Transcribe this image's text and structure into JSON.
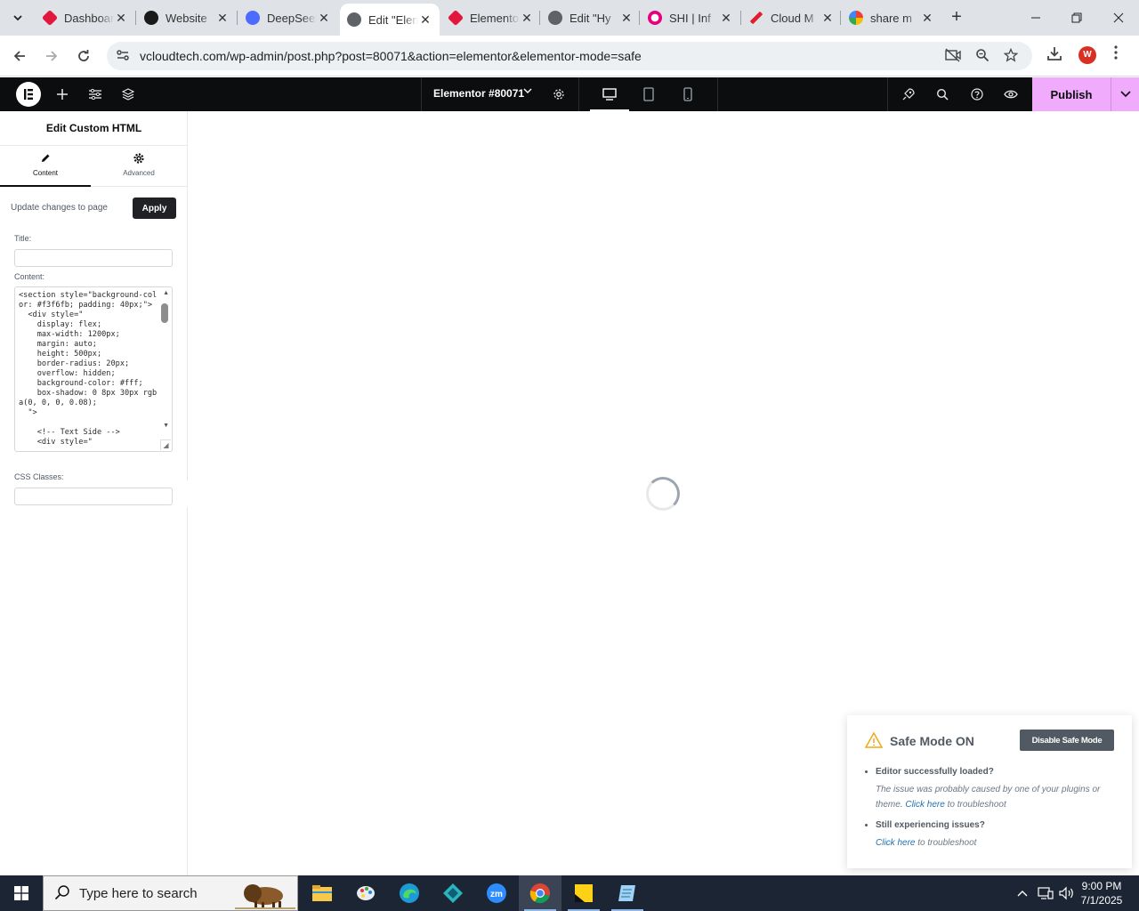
{
  "browser": {
    "tabs": [
      {
        "label": "Dashboard",
        "fav": "#e2173e"
      },
      {
        "label": "Website",
        "fav": "#1a1a1a"
      },
      {
        "label": "DeepSeek",
        "fav": "#4d6bfe"
      },
      {
        "label": "Edit \"Elementor\"",
        "fav": "#555555"
      },
      {
        "label": "Elementor",
        "fav": "#e2173e"
      },
      {
        "label": "Edit \"Hy",
        "fav": "#555555"
      },
      {
        "label": "SHI | Inf",
        "fav": "#e4007f"
      },
      {
        "label": "Cloud M",
        "fav": "#e21d2c"
      },
      {
        "label": "share m",
        "fav": "#4285f4"
      }
    ],
    "active_tab_index": 3,
    "url": "vcloudtech.com/wp-admin/post.php?post=80071&action=elementor&elementor-mode=safe",
    "profile_initial": "W"
  },
  "elementor": {
    "document_title": "Elementor #80071",
    "publish_label": "Publish",
    "accent": "#f0abfc"
  },
  "panel": {
    "title": "Edit Custom HTML",
    "tabs": [
      {
        "label": "Content",
        "icon": "pencil-icon"
      },
      {
        "label": "Advanced",
        "icon": "gear-icon"
      }
    ],
    "update_text": "Update changes to page",
    "apply_label": "Apply",
    "title_label": "Title:",
    "title_value": "",
    "content_label": "Content:",
    "content_code": "<section style=\"background-color: #f3f6fb; padding: 40px;\">\n  <div style=\"\n    display: flex;\n    max-width: 1200px;\n    margin: auto;\n    height: 500px;\n    border-radius: 20px;\n    overflow: hidden;\n    background-color: #fff;\n    box-shadow: 0 8px 30px rgba(0, 0, 0, 0.08);\n  \">\n\n    <!-- Text Side -->\n    <div style=\"",
    "css_classes_label": "CSS Classes:",
    "css_classes_value": ""
  },
  "safe_mode": {
    "title": "Safe Mode ON",
    "disable_label": "Disable Safe Mode",
    "item1_title": "Editor successfully loaded?",
    "item1_text": "The issue was probably caused by one of your plugins or theme.",
    "item1_link": "Click here",
    "item1_suffix": "to troubleshoot",
    "item2_title": "Still experiencing issues?",
    "item2_link": "Click here",
    "item2_suffix": "to troubleshoot"
  },
  "taskbar": {
    "search_placeholder": "Type here to search",
    "time": "9:00 PM",
    "date": "7/1/2025"
  }
}
